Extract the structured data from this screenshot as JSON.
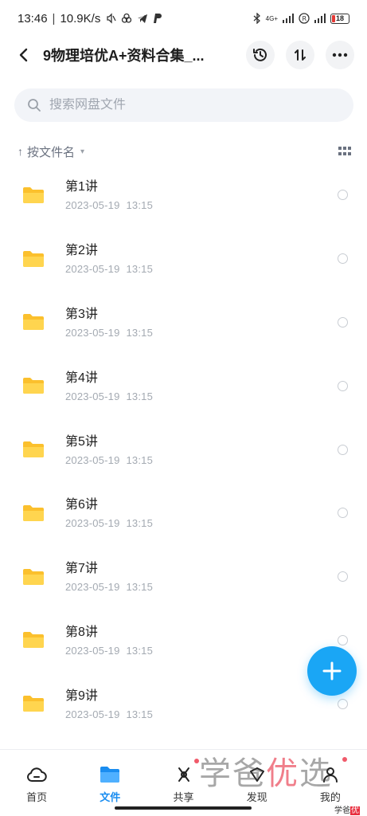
{
  "status_bar": {
    "time": "13:46",
    "speed": "10.9K/s",
    "network": "4G+",
    "battery": "18"
  },
  "top_bar": {
    "title": "9物理培优A+资料合集_...",
    "back_icon": "chevron-left-icon",
    "history_icon": "history-icon",
    "sort_icon": "transfer-icon",
    "more_icon": "more-horizontal-icon"
  },
  "search": {
    "placeholder": "搜索网盘文件"
  },
  "sort": {
    "label": "按文件名"
  },
  "files": [
    {
      "name": "第1讲",
      "date": "2023-05-19",
      "time": "13:15"
    },
    {
      "name": "第2讲",
      "date": "2023-05-19",
      "time": "13:15"
    },
    {
      "name": "第3讲",
      "date": "2023-05-19",
      "time": "13:15"
    },
    {
      "name": "第4讲",
      "date": "2023-05-19",
      "time": "13:15"
    },
    {
      "name": "第5讲",
      "date": "2023-05-19",
      "time": "13:15"
    },
    {
      "name": "第6讲",
      "date": "2023-05-19",
      "time": "13:15"
    },
    {
      "name": "第7讲",
      "date": "2023-05-19",
      "time": "13:15"
    },
    {
      "name": "第8讲",
      "date": "2023-05-19",
      "time": "13:15"
    },
    {
      "name": "第9讲",
      "date": "2023-05-19",
      "time": "13:15"
    }
  ],
  "tabs": [
    {
      "label": "首页"
    },
    {
      "label": "文件"
    },
    {
      "label": "共享"
    },
    {
      "label": "发现"
    },
    {
      "label": "我的"
    }
  ],
  "watermark": {
    "text_a": "学爸",
    "text_b": "优",
    "text_c": "选",
    "small_a": "学爸",
    "small_b": "优",
    "small_c": "选"
  },
  "colors": {
    "accent": "#1a8df0",
    "fab": "#1aa6f5",
    "folder": "#fbc02d"
  }
}
